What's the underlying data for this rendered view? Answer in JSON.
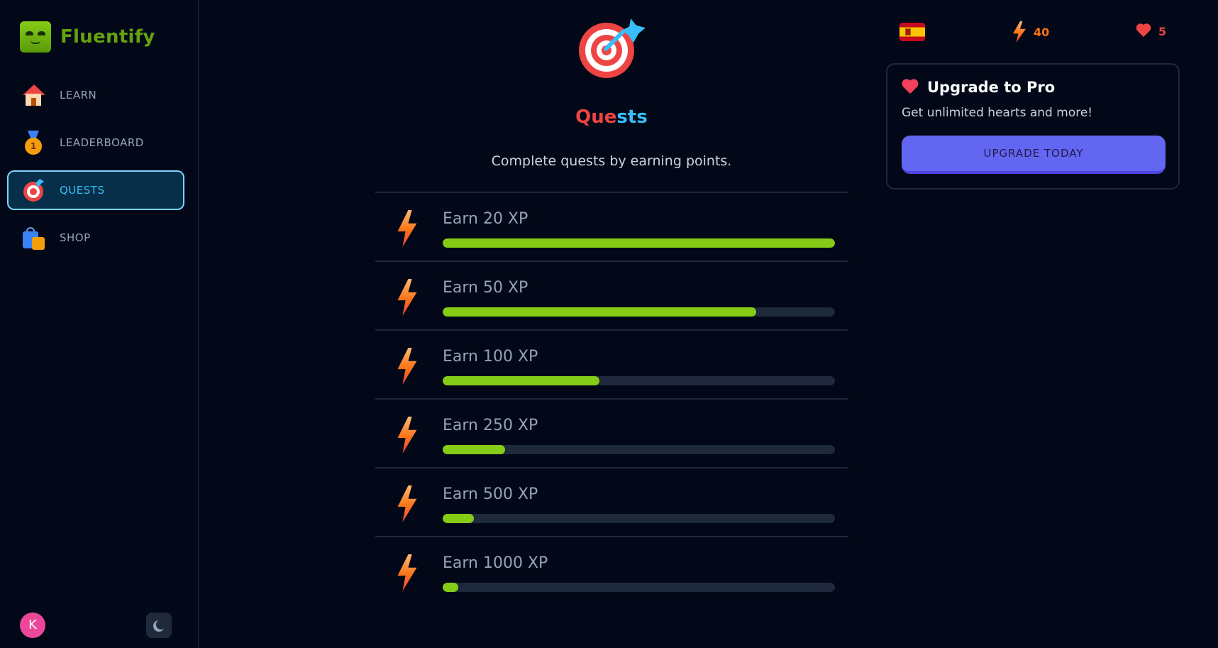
{
  "brand": {
    "name": "Fluentify"
  },
  "nav": [
    {
      "label": "LEARN",
      "icon": "house-icon",
      "active": false
    },
    {
      "label": "LEADERBOARD",
      "icon": "medal-icon",
      "active": false
    },
    {
      "label": "QUESTS",
      "icon": "target-icon",
      "active": true
    },
    {
      "label": "SHOP",
      "icon": "shopping-bag-icon",
      "active": false
    }
  ],
  "user": {
    "avatar_initial": "K"
  },
  "main": {
    "title_part1": "Que",
    "title_part2": "sts",
    "subtitle": "Complete quests by earning points.",
    "quests": [
      {
        "label": "Earn 20 XP",
        "progress": 1.0
      },
      {
        "label": "Earn 50 XP",
        "progress": 0.8
      },
      {
        "label": "Earn 100 XP",
        "progress": 0.4
      },
      {
        "label": "Earn 250 XP",
        "progress": 0.16
      },
      {
        "label": "Earn 500 XP",
        "progress": 0.08
      },
      {
        "label": "Earn 1000 XP",
        "progress": 0.04
      }
    ]
  },
  "stats": {
    "language_flag": "spain-flag",
    "xp": "40",
    "hearts": "5"
  },
  "promo": {
    "title": "Upgrade to Pro",
    "text": "Get unlimited hearts and more!",
    "button_label": "UPGRADE TODAY"
  },
  "colors": {
    "accent": "#84cc16",
    "active": "#38bdf8",
    "button": "#6366f1",
    "hearts": "#ef4444",
    "xp": "#f97316"
  }
}
